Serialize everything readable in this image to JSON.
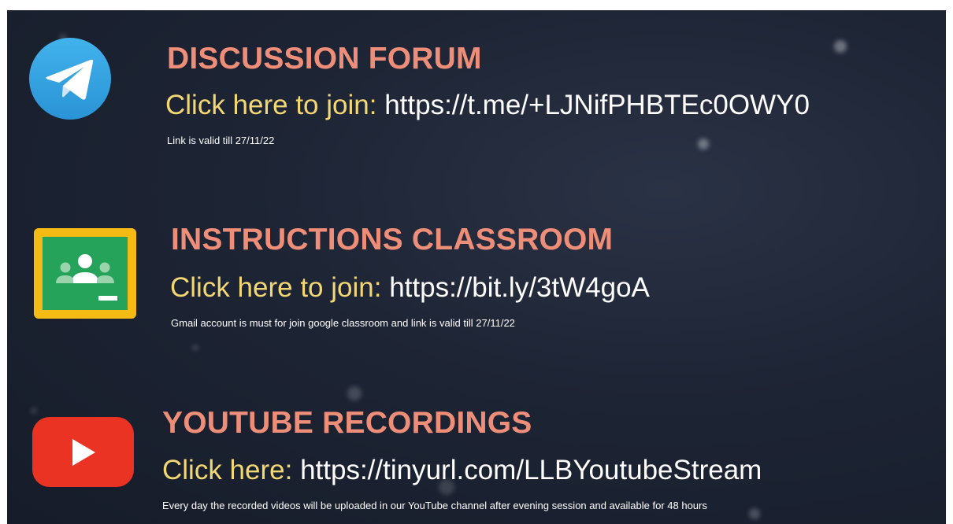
{
  "colors": {
    "background": "#1b2231",
    "heading": "#ee8e78",
    "prompt": "#f3d772",
    "url": "#ffffff",
    "note": "#ffffff"
  },
  "sections": [
    {
      "icon": "telegram-icon",
      "heading": "DISCUSSION FORUM",
      "prompt": "Click here to join:",
      "url": "https://t.me/+LJNifPHBTEc0OWY0",
      "note": "Link is valid till 27/11/22"
    },
    {
      "icon": "google-classroom-icon",
      "heading": "INSTRUCTIONS CLASSROOM",
      "prompt": "Click here to join:",
      "url": "https://bit.ly/3tW4goA",
      "note": "Gmail account is must for join google classroom and link is valid till 27/11/22"
    },
    {
      "icon": "youtube-icon",
      "heading": "YOUTUBE RECORDINGS",
      "prompt": "Click here:",
      "url": "https://tinyurl.com/LLBYoutubeStream",
      "note": "Every day the recorded videos will be uploaded in our YouTube channel after evening session and available for 48 hours"
    }
  ]
}
